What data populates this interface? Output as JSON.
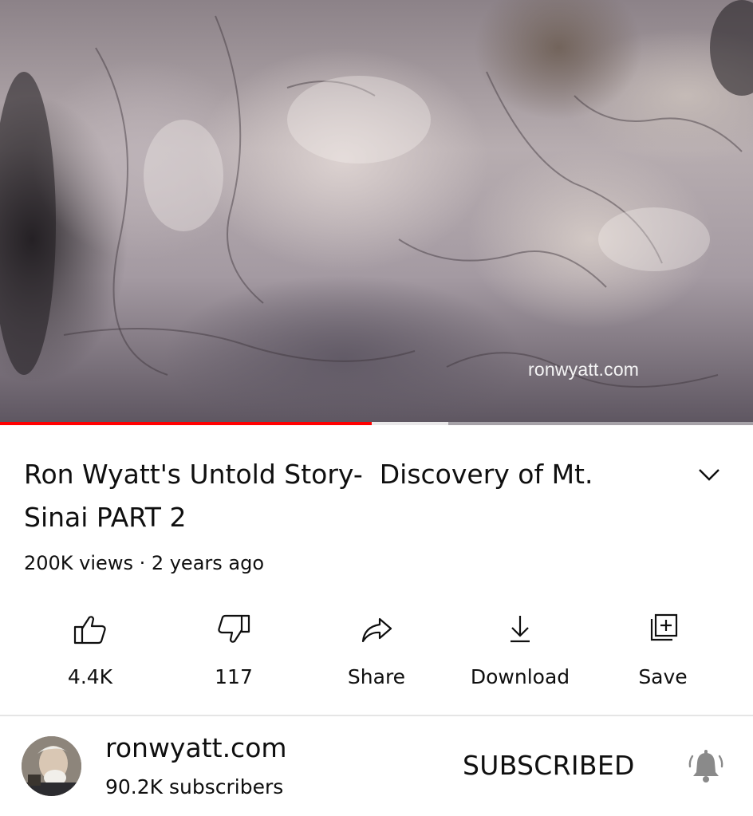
{
  "player": {
    "watermark": "ronwyatt.com",
    "progress_played_fraction": 0.494,
    "progress_buffered_fraction": 0.595,
    "accent_color": "#ff0000"
  },
  "video": {
    "title": "Ron Wyatt's Untold Story-  Discovery of Mt.\nSinai PART 2",
    "meta": "200K views · 2 years ago",
    "expand_icon": "chevron-down-icon"
  },
  "actions": [
    {
      "id": "like",
      "label": "4.4K",
      "icon": "thumbs-up-icon"
    },
    {
      "id": "dislike",
      "label": "117",
      "icon": "thumbs-down-icon"
    },
    {
      "id": "share",
      "label": "Share",
      "icon": "share-arrow-icon"
    },
    {
      "id": "download",
      "label": "Download",
      "icon": "download-icon"
    },
    {
      "id": "save",
      "label": "Save",
      "icon": "add-to-playlist-icon"
    }
  ],
  "channel": {
    "name": "ronwyatt.com",
    "subscribers": "90.2K subscribers",
    "subscribe_state": "SUBSCRIBED",
    "notification_icon": "bell-icon"
  }
}
